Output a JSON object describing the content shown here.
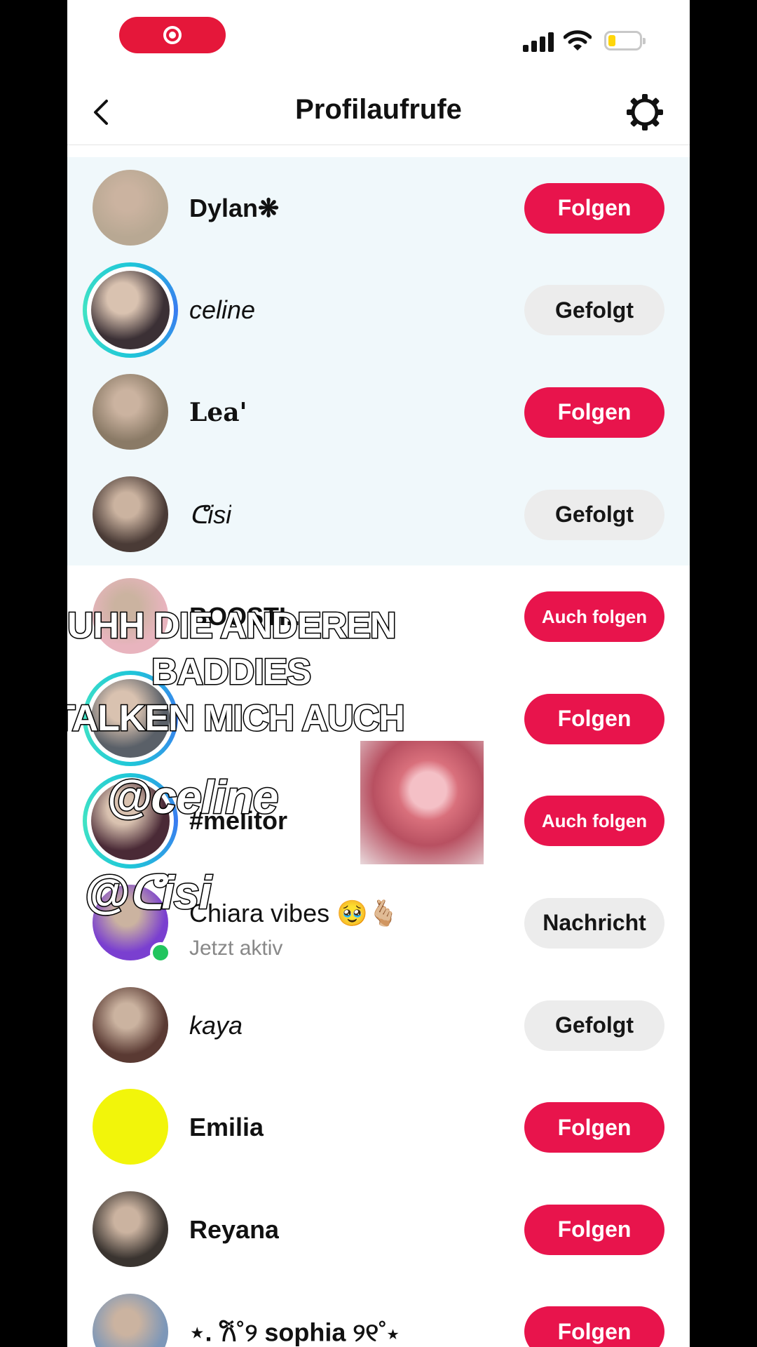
{
  "status_bar": {
    "recording": true
  },
  "header": {
    "title": "Profilaufrufe"
  },
  "rows": [
    {
      "name": "Dylan❋",
      "button": "Folgen",
      "style": "bold",
      "avatar": "#b8a893",
      "highlight": true
    },
    {
      "name": "celine",
      "button": "Gefolgt",
      "style": "italic",
      "avatar": "#3b3035",
      "highlight": true,
      "story": true
    },
    {
      "name": "Lea'",
      "button": "Folgen",
      "style": "serif",
      "avatar": "#8a7a66",
      "highlight": true
    },
    {
      "name": "ᕦisi",
      "button": "Gefolgt",
      "style": "italic",
      "avatar": "#4a3b36",
      "highlight": true
    },
    {
      "name": "BOOSTI...",
      "button": "Auch folgen",
      "style": "bold",
      "avatar": "#e8b4be"
    },
    {
      "name": "",
      "button": "Folgen",
      "style": "bold",
      "avatar": "#5a6068",
      "story": true
    },
    {
      "name": "#melitor",
      "button": "Auch folgen",
      "style": "bold",
      "avatar": "#4a2a36",
      "story": true
    },
    {
      "name": "Chiara vibes 🥹🫰🏼",
      "subtitle": "Jetzt aktiv",
      "button": "Nachricht",
      "style": "normal",
      "avatar": "#7a3fd0",
      "online": true
    },
    {
      "name": "kaya",
      "button": "Gefolgt",
      "style": "italic",
      "avatar": "#5a3a33"
    },
    {
      "name": "Emilia",
      "button": "Folgen",
      "style": "bold",
      "avatar": "#f2f50a"
    },
    {
      "name": "Reyana",
      "button": "Folgen",
      "style": "bold",
      "avatar": "#3a3430"
    },
    {
      "name": "⋆. 𐙚˚୨ sophia ୨୧˚⋆",
      "button": "Folgen",
      "style": "bold",
      "avatar": "#7d97b8"
    }
  ],
  "overlay": {
    "line1": "UHH DIE ANDEREN",
    "line2": "BADDIES",
    "line3": "STALKEN MICH AUCH",
    "mention1": "@celine",
    "mention2": "@ᕦisi"
  },
  "colors": {
    "accent": "#e8144c",
    "secondary": "#ececec",
    "highlight": "#f0f8fb"
  }
}
